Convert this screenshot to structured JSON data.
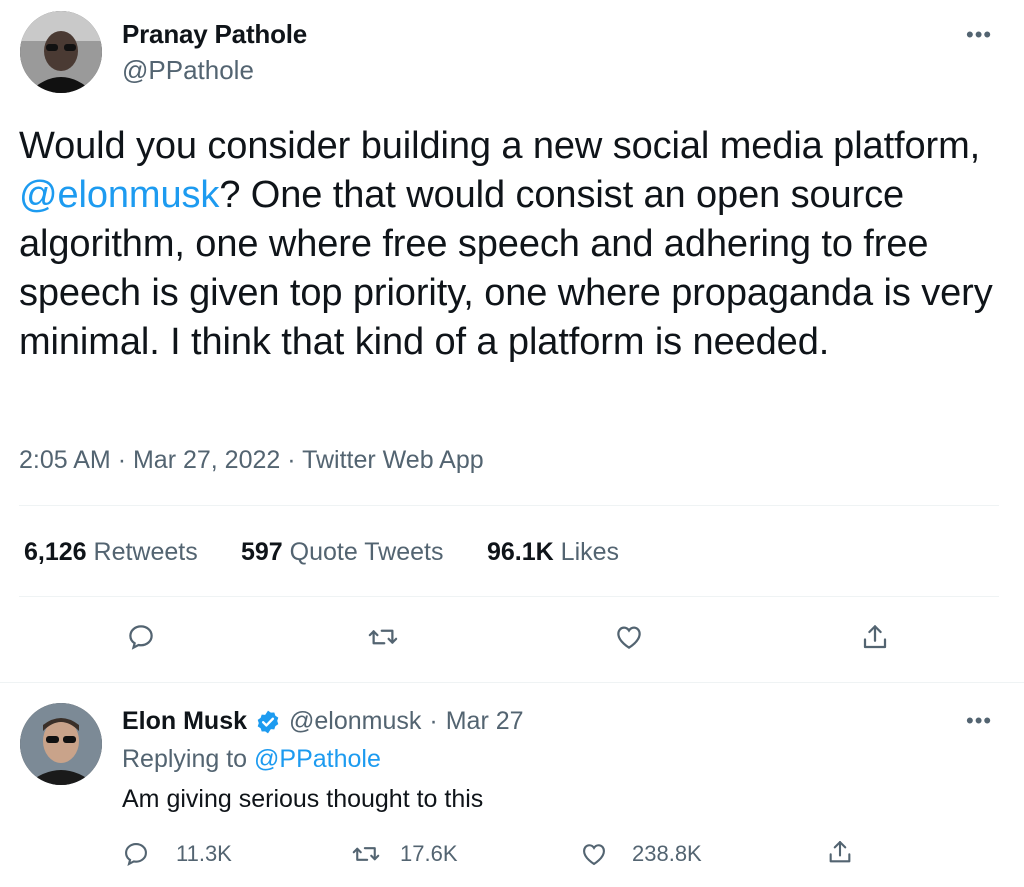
{
  "tweet": {
    "author_name": "Pranay Pathole",
    "author_handle": "@PPathole",
    "text_part1": "Would you consider building a new social media platform, ",
    "mention": "@elonmusk",
    "text_part2": "? One that would consist an open source algorithm, one where free speech and adhering to free speech is given top priority, one where propaganda is very minimal. I think that kind of a platform is needed.",
    "time": "2:05 AM",
    "date": "Mar 27, 2022",
    "source": "Twitter Web App",
    "separator": "·",
    "more": "•••"
  },
  "stats": {
    "retweets_count": "6,126",
    "retweets_label": "Retweets",
    "quotes_count": "597",
    "quotes_label": "Quote Tweets",
    "likes_count": "96.1K",
    "likes_label": "Likes"
  },
  "actions": [
    "reply-icon",
    "retweet-icon",
    "like-icon",
    "share-icon"
  ],
  "reply": {
    "author_name": "Elon Musk",
    "author_handle": "@elonmusk",
    "separator": "·",
    "date": "Mar 27",
    "replying_prefix": "Replying to",
    "replying_to": "@PPathole",
    "text": "Am giving serious thought to this",
    "replies": "11.3K",
    "retweets": "17.6K",
    "likes": "238.8K",
    "more": "•••"
  },
  "colors": {
    "accent": "#1d9bf0",
    "text": "#0f1419",
    "secondary": "#536471",
    "divider": "#eff3f4"
  }
}
